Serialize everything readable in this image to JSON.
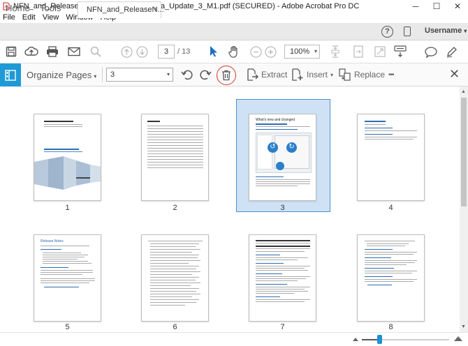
{
  "window": {
    "title": "NFN_and_ReleaseNotes_Acrobat_DC_Beta_Update_3_M1.pdf (SECURED) - Adobe Acrobat Pro DC",
    "controls": {
      "minimize": "─",
      "maximize": "☐",
      "close": "✕"
    }
  },
  "menu": [
    "File",
    "Edit",
    "View",
    "Window",
    "Help"
  ],
  "tabs": {
    "home": "Home",
    "tools": "Tools",
    "document": "NFN_and_ReleaseN...",
    "close": "×"
  },
  "account": {
    "help": "?",
    "username": "Username",
    "caret": "▾"
  },
  "toolbar": {
    "page_current": "3",
    "page_total": "/ 13",
    "zoom": "100%",
    "caret": "▾"
  },
  "organize": {
    "title": "Organize Pages",
    "caret": "▾",
    "page_range": "3",
    "extract": "Extract",
    "insert": "Insert",
    "replace": "Replace",
    "more": "•••",
    "close": "✕"
  },
  "pages": [
    {
      "number": "1",
      "selected": false
    },
    {
      "number": "2",
      "selected": false
    },
    {
      "number": "3",
      "selected": true
    },
    {
      "number": "4",
      "selected": false
    },
    {
      "number": "5",
      "selected": false
    },
    {
      "number": "6",
      "selected": false
    },
    {
      "number": "7",
      "selected": false
    },
    {
      "number": "8",
      "selected": false
    }
  ],
  "page5_heading": "Release Notes",
  "page3_heading": "What's new and changed",
  "scroll": {
    "up": "▲",
    "down": "▼"
  },
  "colors": {
    "accent": "#1f9ad6",
    "selection": "#cfe2f5",
    "delete_highlight": "#d23a2b"
  },
  "icons": [
    "save-icon",
    "upload-icon",
    "print-icon",
    "mail-icon",
    "search-icon",
    "page-up-icon",
    "page-down-icon",
    "select-cursor-icon",
    "hand-icon",
    "zoom-out-icon",
    "zoom-in-icon",
    "rotate-ccw-icon",
    "rotate-cw-icon",
    "trash-icon",
    "extract-icon",
    "insert-icon",
    "replace-icon",
    "comment-icon",
    "pen-icon"
  ]
}
